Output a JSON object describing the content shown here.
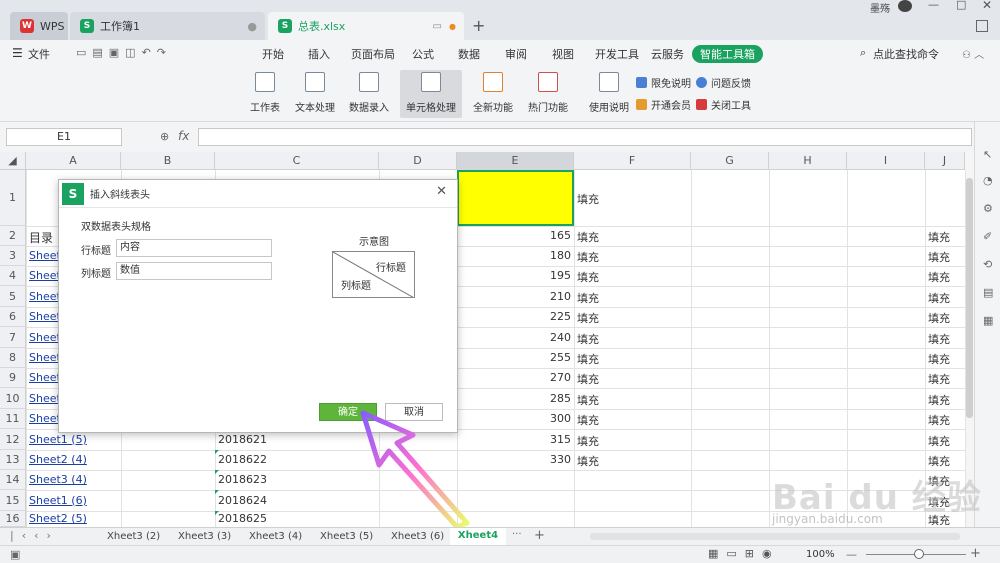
{
  "titlebar": {
    "user": "墨殇",
    "tabs": [
      {
        "label": "WPS"
      },
      {
        "label": "工作簿1"
      },
      {
        "label": "总表.xlsx"
      }
    ]
  },
  "menubar": {
    "file": "文件",
    "items": [
      "开始",
      "插入",
      "页面布局",
      "公式",
      "数据",
      "审阅",
      "视图",
      "开发工具",
      "云服务"
    ],
    "active": "智能工具箱",
    "search": "点此查找命令"
  },
  "toolbar": {
    "buttons": [
      "工作表",
      "文本处理",
      "数据录入",
      "单元格处理",
      "全新功能",
      "热门功能",
      "使用说明"
    ],
    "small": [
      "限免说明",
      "问题反馈",
      "开通会员",
      "关闭工具"
    ]
  },
  "formula_bar": {
    "cell_ref": "E1",
    "fx": "fx",
    "content": ""
  },
  "columns": [
    "A",
    "B",
    "C",
    "D",
    "E",
    "F",
    "G",
    "H",
    "I",
    "J"
  ],
  "rows": [
    "1",
    "2",
    "3",
    "4",
    "5",
    "6",
    "7",
    "8",
    "9",
    "10",
    "11",
    "12",
    "13",
    "14",
    "15",
    "16"
  ],
  "colA": [
    "",
    "目录",
    "Sheet",
    "Sheet",
    "Sheet",
    "Sheet",
    "Sheet",
    "Sheet",
    "Sheet",
    "Sheet",
    "Sheet",
    "Sheet1 (5)",
    "Sheet2 (4)",
    "Sheet3 (4)",
    "Sheet1 (6)",
    "Sheet2 (5)"
  ],
  "colC": [
    "",
    "",
    "",
    "",
    "",
    "",
    "",
    "",
    "",
    "",
    "",
    "2018621",
    "2018622",
    "2018623",
    "2018624",
    "2018625"
  ],
  "colE": [
    "",
    "165",
    "180",
    "195",
    "210",
    "225",
    "240",
    "255",
    "270",
    "285",
    "300",
    "315",
    "330",
    "",
    "",
    ""
  ],
  "colF": [
    "填充",
    "填充",
    "填充",
    "填充",
    "填充",
    "填充",
    "填充",
    "填充",
    "填充",
    "填充",
    "填充",
    "填充",
    "填充",
    "",
    "",
    ""
  ],
  "colJ": [
    "",
    "填充",
    "填充",
    "填充",
    "填充",
    "填充",
    "填充",
    "填充",
    "填充",
    "填充",
    "填充",
    "填充",
    "填充",
    "填充",
    "填充",
    "填充"
  ],
  "dialog": {
    "title": "插入斜线表头",
    "section": "双数据表头规格",
    "row_label": "行标题",
    "row_value": "内容",
    "col_label": "列标题",
    "col_value": "数值",
    "preview_label": "示意图",
    "preview_row": "行标题",
    "preview_col": "列标题",
    "ok": "确定",
    "cancel": "取消"
  },
  "sheet_tabs": [
    "Xheet3 (2)",
    "Xheet3 (3)",
    "Xheet3 (4)",
    "Xheet3 (5)",
    "Xheet3 (6)",
    "Xheet4"
  ],
  "status": {
    "zoom": "100%"
  },
  "watermark": {
    "brand": "Bai du 经验",
    "url": "jingyan.baidu.com"
  },
  "colors": {
    "accent": "#1aa260",
    "selection_fill": "#ffff00",
    "link": "#1a3fa3"
  }
}
